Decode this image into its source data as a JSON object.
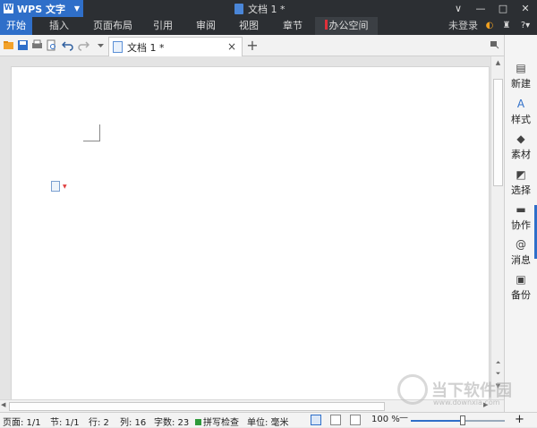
{
  "titlebar": {
    "app_name": "WPS 文字",
    "doc_title": "文档 1 *",
    "window_controls": [
      "∨",
      "—",
      "□",
      "✕"
    ]
  },
  "menu": {
    "tabs": [
      "开始",
      "插入",
      "页面布局",
      "引用",
      "审阅",
      "视图",
      "章节",
      "办公空间"
    ],
    "active_tab": "开始",
    "account": "未登录",
    "help": "?"
  },
  "toolbar": {
    "icons": [
      "open-icon",
      "save-icon",
      "print-icon",
      "preview-icon",
      "undo-icon",
      "redo-icon",
      "more-icon"
    ],
    "document_tab": "文档 1 *",
    "close_tab": "×",
    "add_tab": "+"
  },
  "sidepanel": {
    "items": [
      {
        "label": "新建",
        "icon": "new-doc-icon"
      },
      {
        "label": "样式",
        "icon": "style-icon"
      },
      {
        "label": "素材",
        "icon": "material-icon"
      },
      {
        "label": "选择",
        "icon": "select-icon"
      },
      {
        "label": "协作",
        "icon": "collab-icon"
      },
      {
        "label": "消息",
        "icon": "at-icon"
      },
      {
        "label": "备份",
        "icon": "backup-icon"
      }
    ]
  },
  "statusbar": {
    "page": "页面: 1/1",
    "section": "节: 1/1",
    "row": "行: 2",
    "col": "列: 16",
    "words": "字数: 23",
    "spell": "拼写检查",
    "unit": "单位: 毫米",
    "zoom": "100 %",
    "zoom_minus": "—",
    "zoom_plus": "+",
    "zoom_level": 0.55
  },
  "watermark": {
    "text": "当下软件园",
    "url": "www.downxia.com"
  },
  "colors": {
    "accent": "#2f6fc9",
    "titlebar": "#2c2f33"
  }
}
